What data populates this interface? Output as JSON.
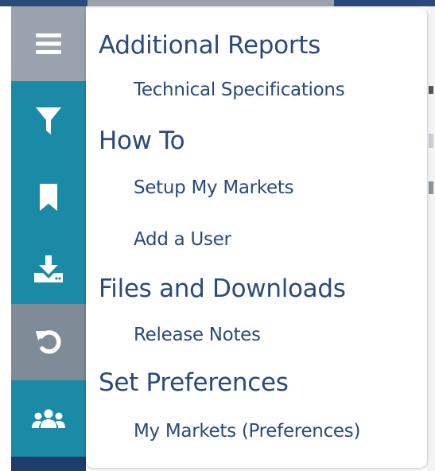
{
  "rail": {
    "menu_icon": "hamburger-menu-icon",
    "filter_icon": "filter-icon",
    "bookmark_icon": "bookmark-icon",
    "download_icon": "download-icon",
    "undo_icon": "undo-icon",
    "users_icon": "users-group-icon",
    "colors": {
      "gray": "#9aa3ad",
      "teal": "#1a8aa6",
      "slate": "#7f8b97",
      "navy": "#1f3d6b"
    }
  },
  "menu": {
    "sections": [
      {
        "heading": "Additional Reports",
        "links": [
          "Technical Specifications"
        ]
      },
      {
        "heading": "How To",
        "links": [
          "Setup My Markets",
          "Add a User"
        ]
      },
      {
        "heading": "Files and Downloads",
        "links": [
          "Release Notes"
        ]
      },
      {
        "heading": "Set Preferences",
        "links": [
          "My Markets (Preferences)"
        ]
      }
    ],
    "text_color": "#2a4a7c"
  }
}
